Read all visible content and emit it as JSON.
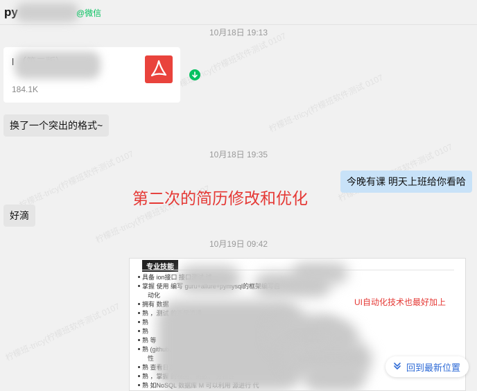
{
  "header": {
    "contact_name": "py",
    "wechat_suffix": "@微信"
  },
  "messages": {
    "time_1": "10月18日 19:13",
    "file": {
      "name": "l              （第二版）",
      "size": "184.1K",
      "icon": "pdf-icon"
    },
    "msg_1": "换了一个突出的格式~",
    "time_2": "10月18日 19:35",
    "msg_2": "今晚有课 明天上班给你看哈",
    "annotation": "第二次的简历修改和优化",
    "msg_3": "好滴",
    "time_3": "10月19日 09:42"
  },
  "document": {
    "section_label": "专业技能",
    "lines": [
      "具备                          ion接口              接口测试                            试",
      "掌握                 使用                  编写                             guru+allure+pymysql的框架编写自",
      "动化",
      "拥有                                  数据",
      "熟                                                 ，测试                            的正常流通",
      "熟",
      "熟",
      "熟                                                                                    等",
      "熟                                                                                       (github，在jenkins配置git下载",
      "性",
      "熟                                                         查看日志。                            级协议",
      "熟                          ，掌握                      的视图、函数、                   分析性",
      "熟                    如NoSQL 数据库 M      可以利用             源进行                      代"
    ],
    "red_note": "UI自动化技术也最好加上"
  },
  "jump_button": {
    "label": "回到最新位置",
    "icon": "double-chevron-down-icon"
  },
  "watermark": "柠檬班-tricy(柠檬班软件测试 0107"
}
